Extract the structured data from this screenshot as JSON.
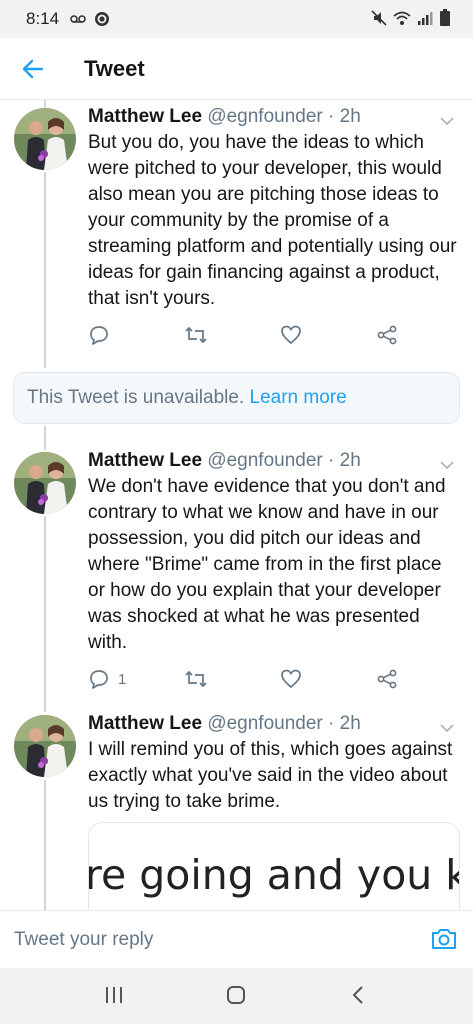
{
  "status_bar": {
    "time": "8:14",
    "left_icons": [
      "voicemail-icon",
      "app-notification-icon"
    ],
    "right_icons": [
      "mute-icon",
      "wifi-icon",
      "signal-icon",
      "battery-icon"
    ]
  },
  "header": {
    "title": "Tweet"
  },
  "tweets": [
    {
      "name": "Matthew Lee",
      "handle": "@egnfounder",
      "separator": "·",
      "time": "2h",
      "text": "But you do, you have the ideas to which were pitched to your developer, this would also mean you are pitching those ideas to your community by the promise of a streaming platform and potentially using our ideas for gain financing against a product, that isn't yours.",
      "reply_count": ""
    },
    {
      "name": "Matthew Lee",
      "handle": "@egnfounder",
      "separator": "·",
      "time": "2h",
      "text": "We don't have evidence that you don't and contrary to what we know and have in our possession, you did pitch our ideas and where \"Brime\" came from in the first place or how do you explain that your developer was shocked at what he was presented with.",
      "reply_count": "1"
    },
    {
      "name": "Matthew Lee",
      "handle": "@egnfounder",
      "separator": "·",
      "time": "2h",
      "text": "I will remind you of this, which goes against exactly what you've said in the video about us trying to take brime.",
      "media_caption": "re going and you know"
    }
  ],
  "unavailable": {
    "text": "This Tweet is unavailable.",
    "link": "Learn more"
  },
  "reply": {
    "placeholder": "Tweet your reply"
  },
  "colors": {
    "accent": "#1da1f2",
    "secondary_text": "#657786",
    "divider": "#e6ecf0"
  }
}
